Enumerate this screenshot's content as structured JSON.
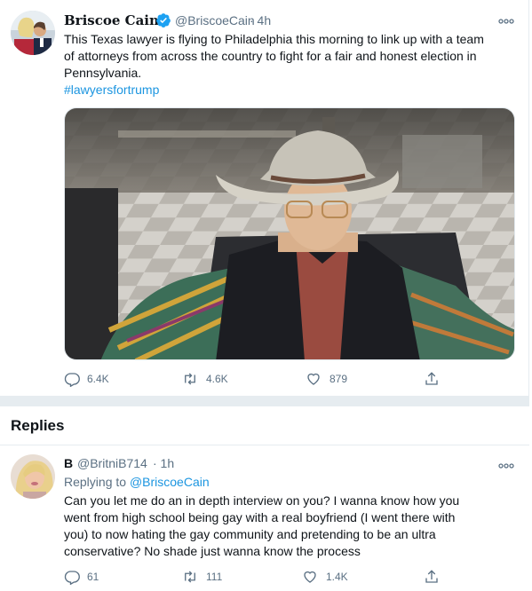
{
  "tweet": {
    "name": "Briscoe Cain",
    "handle": "@BriscoeCain",
    "time": "· 4h",
    "text_lines": [
      "This Texas lawyer is flying to Philadelphia this morning to link up with a team",
      "of attorneys from across the country to fight for a fair and honest election in",
      "Pennsylvania."
    ],
    "hashtag": "#lawyersfortrump",
    "replies": "6.4K",
    "retweets": "4.6K",
    "likes": "879",
    "verified_icon": "verified-badge-icon",
    "more_icon": "more-options-icon"
  },
  "replies_section": {
    "title": "Replies"
  },
  "reply": {
    "name": "B",
    "handle": "@BritniB714",
    "time": "· 1h",
    "replying_to_prefix": "Replying to ",
    "replying_to_handle": "@BriscoeCain",
    "text_lines": [
      "Can you let me do an in depth interview on you? I wanna know how you",
      "went from high school being gay with a real boyfriend (I went there with",
      "you) to now hating the gay community and pretending to be an ultra",
      "conservative? No shade just wanna know the process"
    ],
    "replies": "61",
    "retweets": "111",
    "likes": "1.4K"
  },
  "colors": {
    "link": "#1b95e0",
    "muted": "#5b7083",
    "divider": "#e6ecf0",
    "verified": "#1da1f2"
  }
}
